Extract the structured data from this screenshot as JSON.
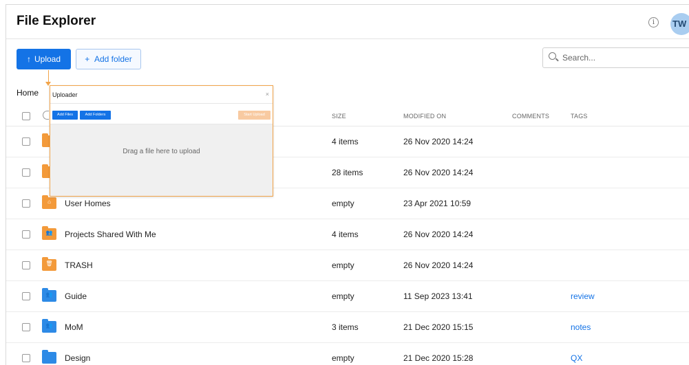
{
  "header": {
    "title": "File Explorer",
    "info_icon": "info-circle-icon",
    "avatar_initials": "TW"
  },
  "toolbar": {
    "upload_icon": "↑",
    "upload_label": "Upload",
    "add_folder_icon": "+",
    "add_folder_label": "Add folder"
  },
  "search": {
    "placeholder": "Search..."
  },
  "breadcrumb": {
    "home": "Home"
  },
  "table": {
    "columns": {
      "size": "SIZE",
      "modified": "MODIFIED ON",
      "comments": "COMMENTS",
      "tags": "TAGS"
    },
    "rows": [
      {
        "name": "",
        "size": "4 items",
        "modified": "26 Nov 2020 14:24",
        "tag": "",
        "icon": "folder-icon",
        "color": "#f39a3a"
      },
      {
        "name": "",
        "size": "28 items",
        "modified": "26 Nov 2020 14:24",
        "tag": "",
        "icon": "folder-icon",
        "color": "#f39a3a"
      },
      {
        "name": "User Homes",
        "size": "empty",
        "modified": "23 Apr 2021 10:59",
        "tag": "",
        "icon": "home-folder-icon",
        "color": "#f39a3a"
      },
      {
        "name": "Projects Shared With Me",
        "size": "4 items",
        "modified": "26 Nov 2020 14:24",
        "tag": "",
        "icon": "shared-folder-icon",
        "color": "#f39a3a"
      },
      {
        "name": "TRASH",
        "size": "empty",
        "modified": "26 Nov 2020 14:24",
        "tag": "",
        "icon": "trash-folder-icon",
        "color": "#f39a3a"
      },
      {
        "name": "Guide",
        "size": "empty",
        "modified": "11 Sep 2023 13:41",
        "tag": "review",
        "icon": "shared-folder-icon",
        "color": "#2d8ae6"
      },
      {
        "name": "MoM",
        "size": "3 items",
        "modified": "21 Dec 2020 15:15",
        "tag": "notes",
        "icon": "shared-folder-icon",
        "color": "#2d8ae6"
      },
      {
        "name": "Design",
        "size": "empty",
        "modified": "21 Dec 2020 15:28",
        "tag": "QX",
        "icon": "folder-icon",
        "color": "#2d8ae6"
      }
    ]
  },
  "uploader": {
    "title": "Uploader",
    "close": "×",
    "add_files": "Add Files",
    "add_folders": "Add Folders",
    "start_upload": "Start Upload",
    "drop_text": "Drag a file here to upload"
  },
  "colors": {
    "accent": "#1473e6",
    "uploader_border": "#f2a44a",
    "folder_orange": "#f39a3a",
    "folder_blue": "#2d8ae6"
  }
}
